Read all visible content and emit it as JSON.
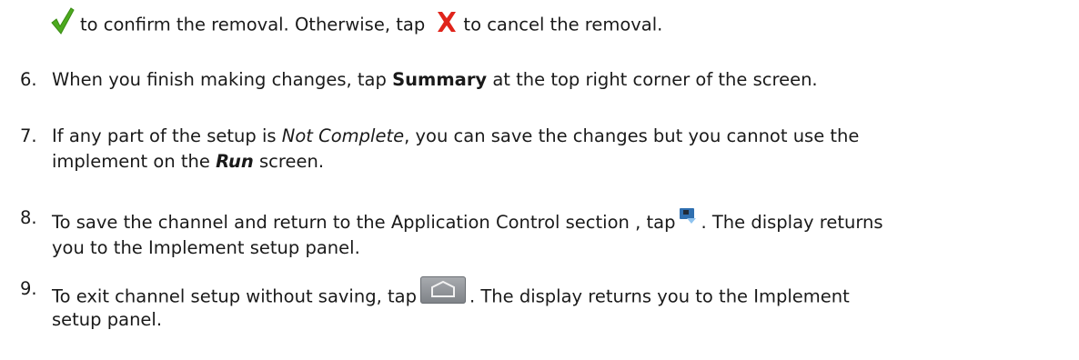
{
  "intro": {
    "text_a": "to confirm the removal. Otherwise, tap",
    "text_b": "to cancel the removal.",
    "confirm_icon": "check-icon",
    "cancel_icon": "x-icon"
  },
  "steps": [
    {
      "number": "6.",
      "parts": [
        "When you finish making changes, tap ",
        "Summary",
        " at the top right corner of the screen."
      ]
    },
    {
      "number": "7.",
      "line1": [
        "If any part of the setup is ",
        "Not Complete",
        ", you can save the changes but you cannot use the"
      ],
      "line2": [
        "implement on the ",
        "Run",
        " screen."
      ]
    },
    {
      "number": "8.",
      "line1": [
        "To save the channel and return to the Application Control section , tap",
        ". The display returns"
      ],
      "line2": "you to the Implement setup panel.",
      "icon": "save-icon"
    },
    {
      "number": "9.",
      "line1": [
        "To exit channel setup without saving, tap",
        ". The display returns you to the Implement"
      ],
      "line2": "setup panel.",
      "icon": "home-icon"
    }
  ],
  "colors": {
    "text": "#1a1a1a",
    "check": "#4caa1e",
    "x": "#e0241b"
  }
}
